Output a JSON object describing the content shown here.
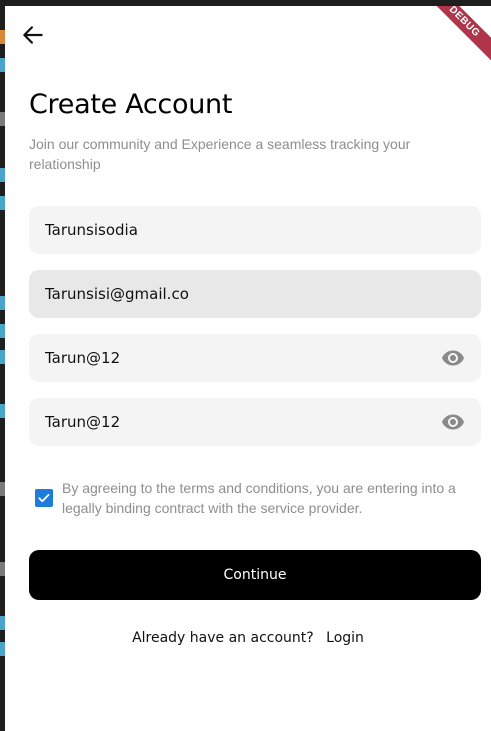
{
  "debug_banner": "DEBUG",
  "header": {
    "back_icon": "arrow-left-icon"
  },
  "title": "Create Account",
  "subtitle": "Join our community and Experience a seamless tracking your relationship",
  "fields": {
    "name": {
      "value": "Tarunsisodia"
    },
    "email": {
      "value": "Tarunsisi@gmail.co"
    },
    "password": {
      "value": "Tarun@12",
      "icon": "eye-icon"
    },
    "confirm_password": {
      "value": "Tarun@12",
      "icon": "eye-icon"
    }
  },
  "terms": {
    "checked": true,
    "text": "By agreeing to the terms and conditions, you are entering into a legally binding contract with the service provider."
  },
  "continue_label": "Continue",
  "login_prompt": {
    "text": "Already have an account?",
    "link": "Login"
  },
  "colors": {
    "primary": "#000000",
    "checkbox": "#1d7bd9",
    "field_bg": "#f4f4f4",
    "muted_text": "#8e8e8e",
    "debug_banner": "#b0344a"
  }
}
